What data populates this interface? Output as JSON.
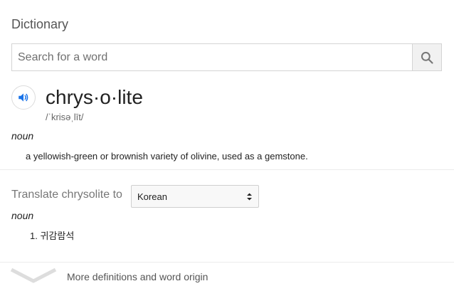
{
  "panel": {
    "title": "Dictionary"
  },
  "search": {
    "placeholder": "Search for a word",
    "value": ""
  },
  "entry": {
    "headword": "chrys·o·lite",
    "phonetic": "/ˈkrisəˌlīt/",
    "part_of_speech": "noun",
    "definition": "a yellowish-green or brownish variety of olivine, used as a gemstone."
  },
  "translate": {
    "label": "Translate chrysolite to",
    "language": "Korean",
    "part_of_speech": "noun",
    "results": [
      "1. 귀감람석"
    ]
  },
  "more": {
    "label": "More definitions and word origin"
  },
  "icons": {
    "search": "search-icon",
    "audio": "speaker-icon",
    "expand": "chevron-down-icon",
    "select_arrows": "select-arrows-icon"
  },
  "colors": {
    "audio_icon": "#1a73e8",
    "search_icon": "#777777",
    "chevron": "#dddddd"
  }
}
